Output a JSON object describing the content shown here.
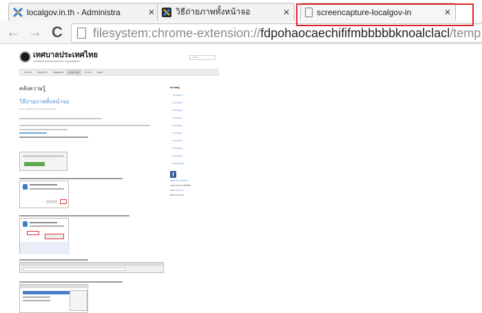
{
  "tabs": [
    {
      "title": "localgov.in.th - Administra",
      "favicon": "x-logo-icon",
      "active": false
    },
    {
      "title": "วิธีถ่ายภาพทั้งหน้าจอ",
      "favicon": "colorful-x-icon",
      "active": false
    },
    {
      "title": "screencapture-localgov-in",
      "favicon": "page-icon",
      "active": true
    }
  ],
  "toolbar": {
    "back_icon": "←",
    "forward_icon": "→",
    "reload_icon": "C",
    "url_prefix": "filesystem:chrome-extension://",
    "url_main": "fdpohaocaechififmbbbbbknoalclacl",
    "url_suffix": "/temp"
  },
  "highlight_color": "#e2232a",
  "site": {
    "logo_main": "เทศบาลประเทศไทย",
    "logo_sub": "Subdistrict Administrative Organization",
    "search_placeholder": "ค้นหา",
    "nav": [
      "หน้าแรก",
      "ข้อมูลทั่วไป",
      "ข้อมูลติดต่อ",
      "คลังความรู้",
      "ข่าวสาร",
      "ติดต่อ"
    ],
    "page_title": "คลังความรู้",
    "post_title": "วิธีถ่ายภาพทั้งหน้าจอ",
    "post_meta": "admin  |  คลังความรู้  |  30 September 2015",
    "sidebar_title": "หมวดหมู่",
    "sidebar_links": [
      "หมวดหมู่ 1",
      "หมวดหมู่ 2",
      "หมวดหมู่ 3",
      "หมวดหมู่ 4",
      "หมวดหมู่ 5",
      "หมวดหมู่ 6",
      "หมวดหมู่ 7",
      "หมวดหมู่ 8",
      "หมวดหมู่ 9",
      "หมวดหมู่ 10"
    ],
    "fb_lines": [
      "เทศบาลประเทศไทย",
      "กลุ่มงานประชาสัมพันธ์",
      "ติดต่อ สอบถาม",
      "ติดตามข่าวสาร"
    ]
  }
}
